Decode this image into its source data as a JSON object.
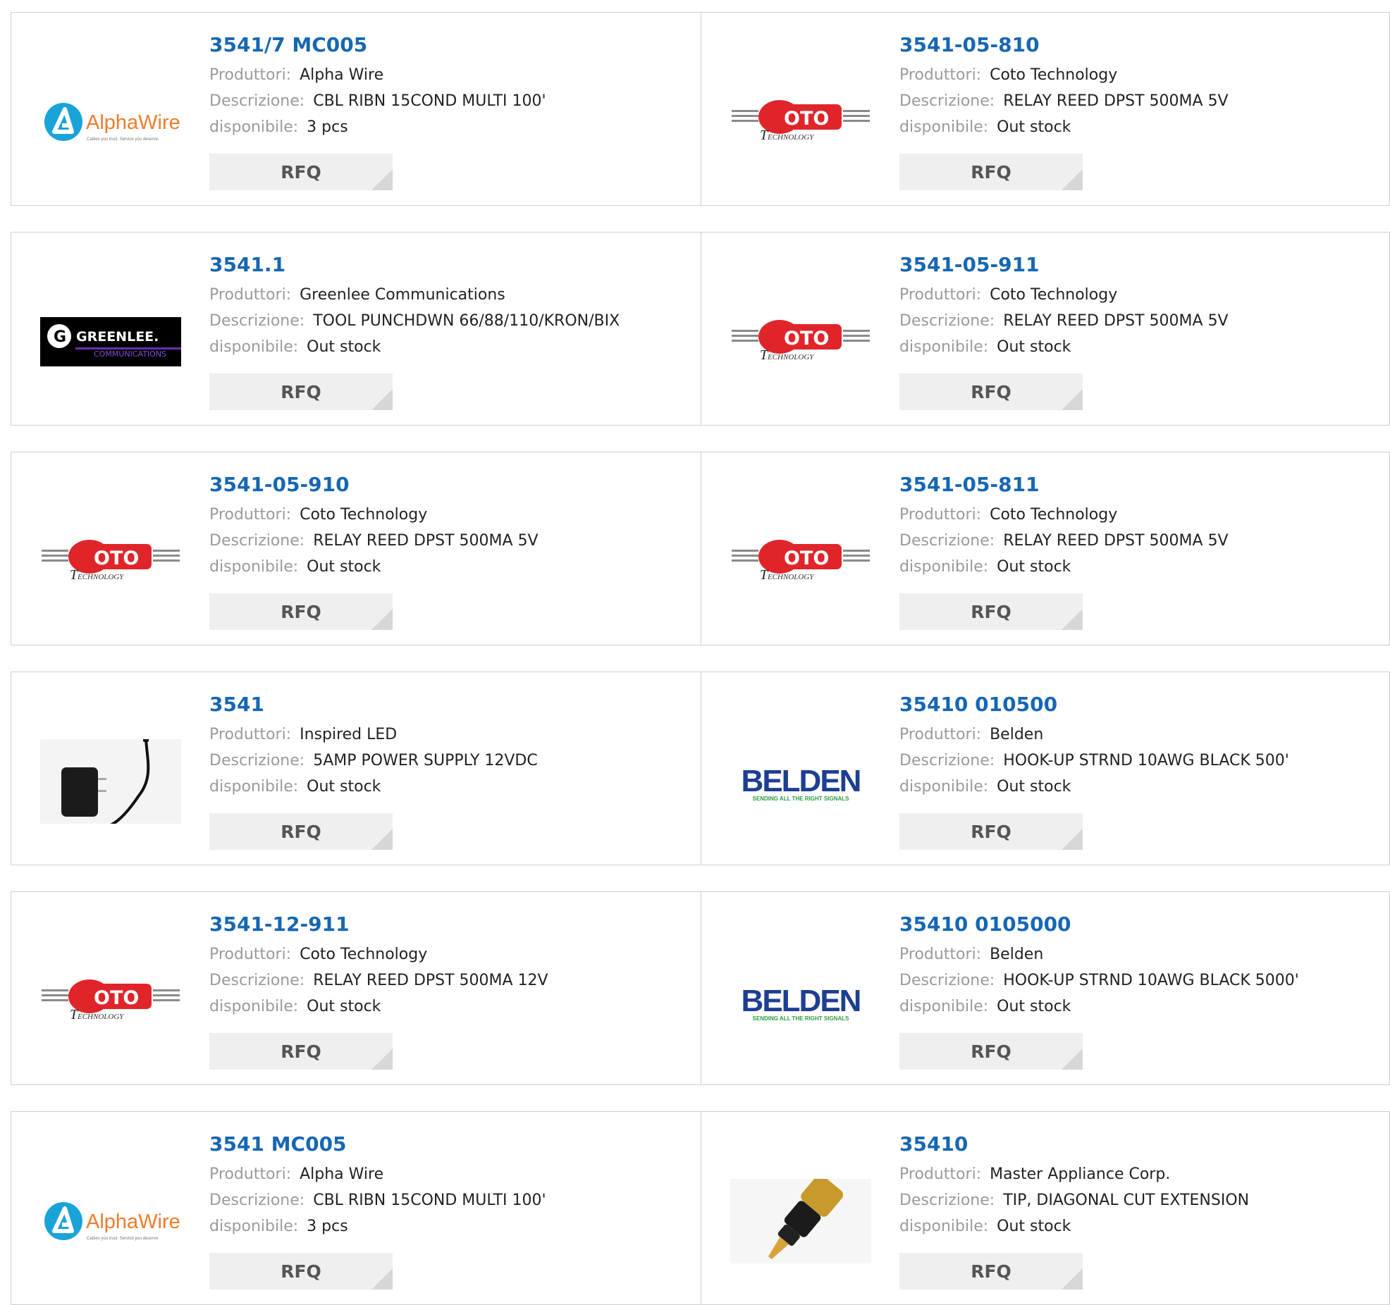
{
  "labels": {
    "manufacturer": "Produttori:",
    "description": "Descrizione:",
    "availability": "disponibile:",
    "rfq": "RFQ"
  },
  "colors": {
    "part_link": "#1667b3",
    "label": "#9a9a9a",
    "value": "#222222",
    "rfq_bg": "#efefef",
    "border": "#cfcfcf"
  },
  "products": [
    {
      "part": "3541/7 MC005",
      "manufacturer": "Alpha Wire",
      "description": "CBL RIBN 15COND MULTI 100'",
      "availability": "3 pcs",
      "logo": "alphawire",
      "logo_text": "AlphaWire",
      "logo_tagline": "Cables you trust. Service you deserve."
    },
    {
      "part": "3541-05-810",
      "manufacturer": "Coto Technology",
      "description": "RELAY REED DPST 500MA 5V",
      "availability": "Out stock",
      "logo": "coto",
      "logo_text": "OTO",
      "logo_sub": "ECHNOLOGY"
    },
    {
      "part": "3541.1",
      "manufacturer": "Greenlee Communications",
      "description": "TOOL PUNCHDWN 66/88/110/KRON/BIX",
      "availability": "Out stock",
      "logo": "greenlee",
      "logo_text": "GREENLEE.",
      "logo_sub": "COMMUNICATIONS"
    },
    {
      "part": "3541-05-911",
      "manufacturer": "Coto Technology",
      "description": "RELAY REED DPST 500MA 5V",
      "availability": "Out stock",
      "logo": "coto",
      "logo_text": "OTO",
      "logo_sub": "ECHNOLOGY"
    },
    {
      "part": "3541-05-910",
      "manufacturer": "Coto Technology",
      "description": "RELAY REED DPST 500MA 5V",
      "availability": "Out stock",
      "logo": "coto",
      "logo_text": "OTO",
      "logo_sub": "ECHNOLOGY"
    },
    {
      "part": "3541-05-811",
      "manufacturer": "Coto Technology",
      "description": "RELAY REED DPST 500MA 5V",
      "availability": "Out stock",
      "logo": "coto",
      "logo_text": "OTO",
      "logo_sub": "ECHNOLOGY"
    },
    {
      "part": "3541",
      "manufacturer": "Inspired LED",
      "description": "5AMP POWER SUPPLY 12VDC",
      "availability": "Out stock",
      "logo": "power-supply-photo"
    },
    {
      "part": "35410 010500",
      "manufacturer": "Belden",
      "description": "HOOK-UP STRND 10AWG BLACK 500'",
      "availability": "Out stock",
      "logo": "belden",
      "logo_text": "BELDEN",
      "logo_tagline": "SENDING ALL THE RIGHT SIGNALS"
    },
    {
      "part": "3541-12-911",
      "manufacturer": "Coto Technology",
      "description": "RELAY REED DPST 500MA 12V",
      "availability": "Out stock",
      "logo": "coto",
      "logo_text": "OTO",
      "logo_sub": "ECHNOLOGY"
    },
    {
      "part": "35410 0105000",
      "manufacturer": "Belden",
      "description": "HOOK-UP STRND 10AWG BLACK 5000'",
      "availability": "Out stock",
      "logo": "belden",
      "logo_text": "BELDEN",
      "logo_tagline": "SENDING ALL THE RIGHT SIGNALS"
    },
    {
      "part": "3541 MC005",
      "manufacturer": "Alpha Wire",
      "description": "CBL RIBN 15COND MULTI 100'",
      "availability": "3 pcs",
      "logo": "alphawire",
      "logo_text": "AlphaWire",
      "logo_tagline": "Cables you trust. Service you deserve."
    },
    {
      "part": "35410",
      "manufacturer": "Master Appliance Corp.",
      "description": "TIP, DIAGONAL CUT EXTENSION",
      "availability": "Out stock",
      "logo": "solder-tip-photo"
    }
  ]
}
